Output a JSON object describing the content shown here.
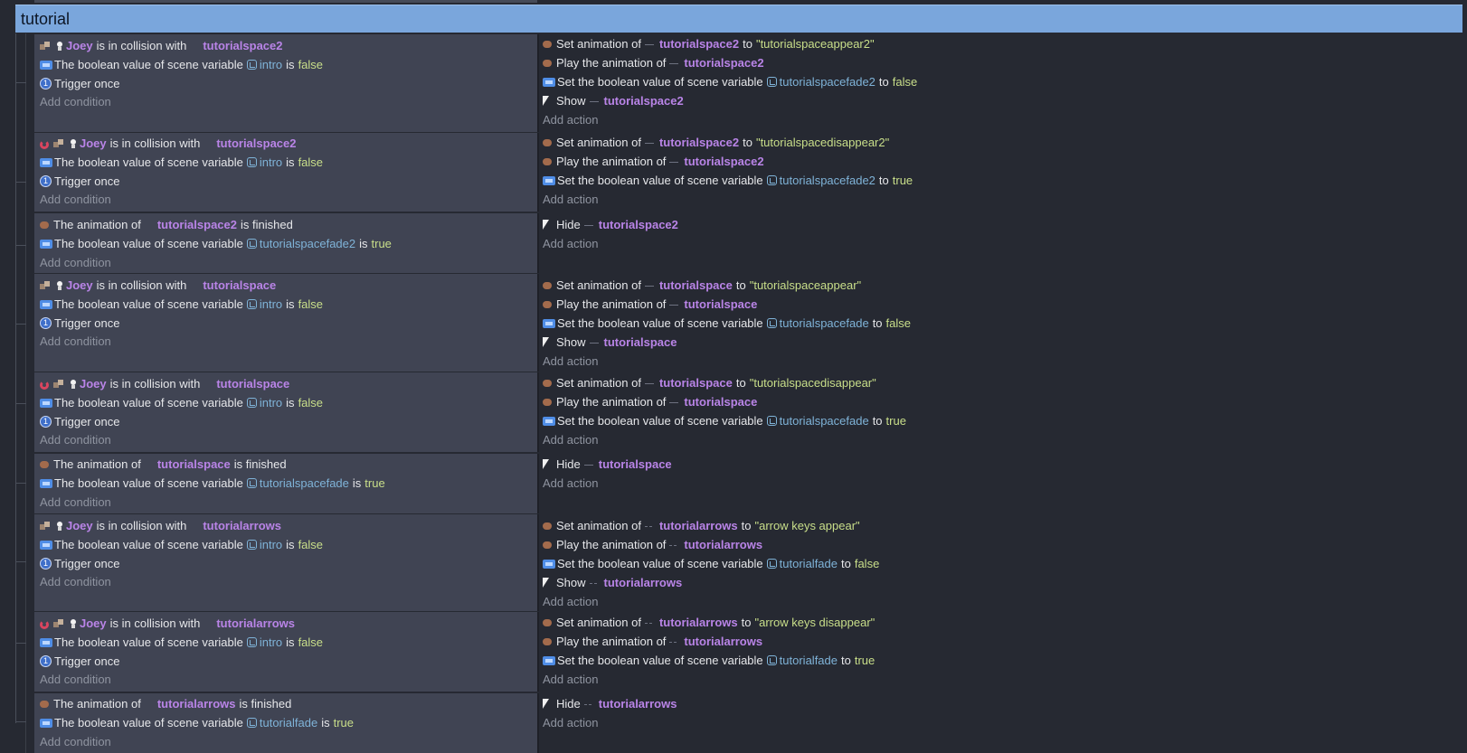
{
  "group": {
    "title": "tutorial"
  },
  "labels": {
    "add_condition": "Add condition",
    "add_action": "Add action",
    "is_in_collision_with": "is in collision with",
    "the_boolean_value_of_scene_variable": "The boolean value of scene variable",
    "is": "is",
    "trigger_once": "Trigger once",
    "the_animation_of": "The animation of",
    "is_finished": "is finished",
    "set_animation_of": "Set animation of",
    "to": "to",
    "play_the_animation_of": "Play the animation of",
    "set_the_boolean_value_of_scene_variable": "Set the boolean value of scene variable",
    "show": "Show",
    "hide": "Hide"
  },
  "objects": {
    "joey": "Joey",
    "tutorialspace2": "tutorialspace2",
    "tutorialspace": "tutorialspace",
    "tutorialarrows": "tutorialarrows"
  },
  "variables": {
    "intro": "intro",
    "tutorialspacefade2": "tutorialspacefade2",
    "tutorialspacefade": "tutorialspacefade",
    "tutorialfade": "tutorialfade"
  },
  "values": {
    "false": "false",
    "true": "true",
    "tutorialspaceappear2": "\"tutorialspaceappear2\"",
    "tutorialspacedisappear2": "\"tutorialspacedisappear2\"",
    "tutorialspaceappear": "\"tutorialspaceappear\"",
    "tutorialspacedisappear": "\"tutorialspacedisappear\"",
    "arrow_keys_appear": "\"arrow keys appear\"",
    "arrow_keys_disappear": "\"arrow keys disappear\""
  },
  "icons": {
    "animation": "animation-icon",
    "sprite": "sprite-icon",
    "joey_object": "joey-object-icon",
    "magnet": "inverted-condition-icon",
    "scene_variable": "scene-variable-icon",
    "trigger_once": "trigger-once-icon",
    "visibility": "visibility-icon"
  },
  "colors": {
    "group_header": "#7aa6dc",
    "conditions_bg": "#404453",
    "actions_bg": "#262932",
    "object_name": "#b984e7",
    "variable_name": "#7fb3d8",
    "value": "#c9df8a"
  }
}
